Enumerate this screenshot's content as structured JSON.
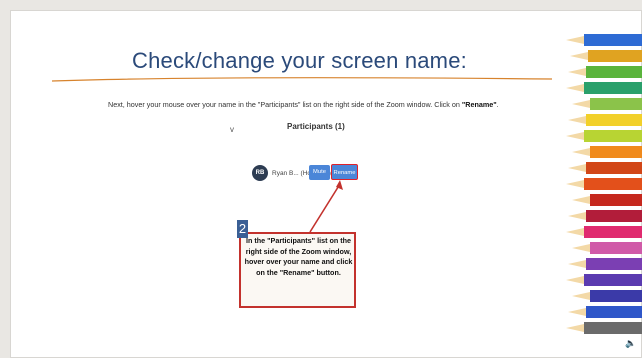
{
  "slide": {
    "title": "Check/change your screen name:",
    "instruction_prefix": "Next, hover your mouse over your name in the \"Participants\" list on the right side of the Zoom window. Click on ",
    "instruction_bold": "\"Rename\"",
    "instruction_suffix": "."
  },
  "zoom_panel": {
    "chevron": "v",
    "participants_header": "Participants (1)",
    "avatar_initials": "RB",
    "participant_name": "Ryan B... (Host, me)",
    "mute_label": "Mute",
    "rename_label": "Rename"
  },
  "callout": {
    "step_number": "2",
    "text": "In the \"Participants\" list on the\nright side of the Zoom window,\nhover over your name and click\non the \"Rename\" button."
  },
  "colors": {
    "title": "#2b4a7a",
    "button_blue": "#4b86d8",
    "highlight_red": "#c3322d",
    "step_badge": "#3a5f95"
  },
  "icons": {
    "speaker": "speaker-icon",
    "pencils": "colored-pencils-decoration"
  }
}
